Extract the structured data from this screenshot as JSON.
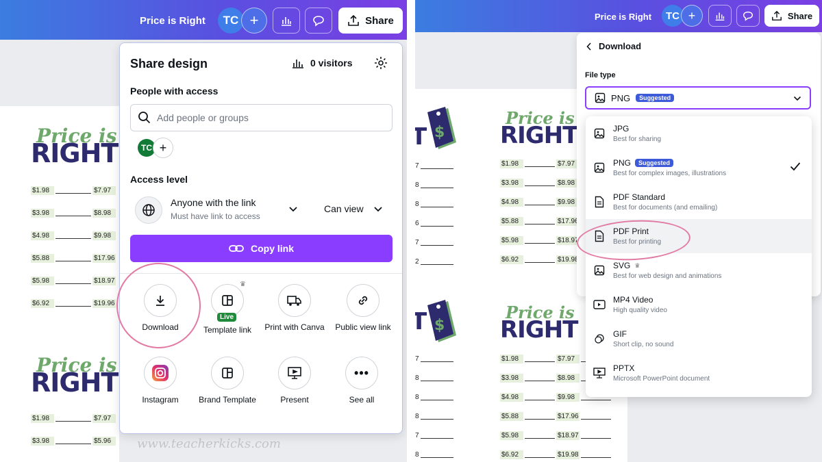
{
  "left": {
    "topbar": {
      "title": "Price is Right",
      "avatar": "TC",
      "add_icon": "+",
      "share_label": "Share"
    },
    "doc": {
      "script_text": "Price is",
      "big_text": "RIGHT",
      "prices_a": [
        "$1.98",
        "$3.98",
        "$4.98",
        "$5.88",
        "$5.98",
        "$6.92"
      ],
      "prices_b": [
        "$7.97",
        "$8.98",
        "$9.98",
        "$17.96",
        "$18.97",
        "$19.96"
      ],
      "second_script": "Price is",
      "second_big": "RIGHT",
      "prices2_a": [
        "$1.98",
        "$3.98"
      ],
      "prices2_b": [
        "$7.97",
        "$5.96"
      ]
    },
    "share_panel": {
      "title": "Share design",
      "visitors": "0 visitors",
      "people_label": "People with access",
      "search_placeholder": "Add people or groups",
      "avatar": "TC",
      "access_label": "Access level",
      "access_value": "Anyone with the link",
      "access_sub": "Must have link to access",
      "permission": "Can view",
      "copy_link": "Copy link",
      "options": [
        {
          "label": "Download",
          "icon": "download-icon"
        },
        {
          "label": "Template link",
          "icon": "template-link-icon",
          "badge": "Live"
        },
        {
          "label": "Print with Canva",
          "icon": "truck-icon"
        },
        {
          "label": "Public view link",
          "icon": "link-icon"
        },
        {
          "label": "Instagram",
          "icon": "instagram-icon"
        },
        {
          "label": "Brand Template",
          "icon": "brand-template-icon"
        },
        {
          "label": "Present",
          "icon": "present-icon"
        },
        {
          "label": "See all",
          "icon": "more-icon"
        }
      ]
    },
    "watermark": "www.teacherkicks.com"
  },
  "right": {
    "topbar": {
      "title": "Price is Right",
      "avatar": "TC",
      "add_icon": "+",
      "share_label": "Share"
    },
    "doc": {
      "script_text": "Price is",
      "big_text": "RIGHT",
      "prices_a": [
        "$1.98",
        "$3.98",
        "$4.98",
        "$5.88",
        "$5.98",
        "$6.92"
      ],
      "prices_b": [
        "$7.97",
        "$8.98",
        "$9.98",
        "$17.96",
        "$18.97",
        "$19.98"
      ],
      "second_script": "Price is",
      "second_big": "RIGHT",
      "prices2_a": [
        "$1.98",
        "$3.98",
        "$4.98",
        "$5.88",
        "$5.98",
        "$6.92"
      ],
      "prices2_b": [
        "$7.97",
        "$8.98",
        "$9.98",
        "$17.96",
        "$18.97",
        "$19.98"
      ],
      "left_cut": [
        "7",
        "8",
        "8",
        "6",
        "7",
        "2"
      ],
      "left_cut2": [
        "7",
        "8",
        "8",
        "8",
        "7",
        "8"
      ]
    },
    "download_panel": {
      "back_label": "Download",
      "file_type_label": "File type",
      "selected": "PNG",
      "selected_badge": "Suggested",
      "types": [
        {
          "name": "JPG",
          "desc": "Best for sharing",
          "icon": "image-icon"
        },
        {
          "name": "PNG",
          "desc": "Best for complex images, illustrations",
          "icon": "image-icon",
          "badge": "Suggested",
          "checked": true
        },
        {
          "name": "PDF Standard",
          "desc": "Best for documents (and emailing)",
          "icon": "document-icon"
        },
        {
          "name": "PDF Print",
          "desc": "Best for printing",
          "icon": "document-icon",
          "highlighted": true
        },
        {
          "name": "SVG",
          "desc": "Best for web design and animations",
          "icon": "image-icon",
          "crown": "♛"
        },
        {
          "name": "MP4 Video",
          "desc": "High quality video",
          "icon": "video-icon"
        },
        {
          "name": "GIF",
          "desc": "Short clip, no sound",
          "icon": "gif-icon"
        },
        {
          "name": "PPTX",
          "desc": "Microsoft PowerPoint document",
          "icon": "presentation-icon"
        }
      ]
    }
  },
  "colors": {
    "purple": "#8b3dff",
    "topbar_start": "#3b7de0",
    "topbar_end": "#7b3fe4",
    "highlight_ring": "#e27aa3",
    "brand_green": "#6ea86b",
    "brand_navy": "#2d2a6e"
  }
}
